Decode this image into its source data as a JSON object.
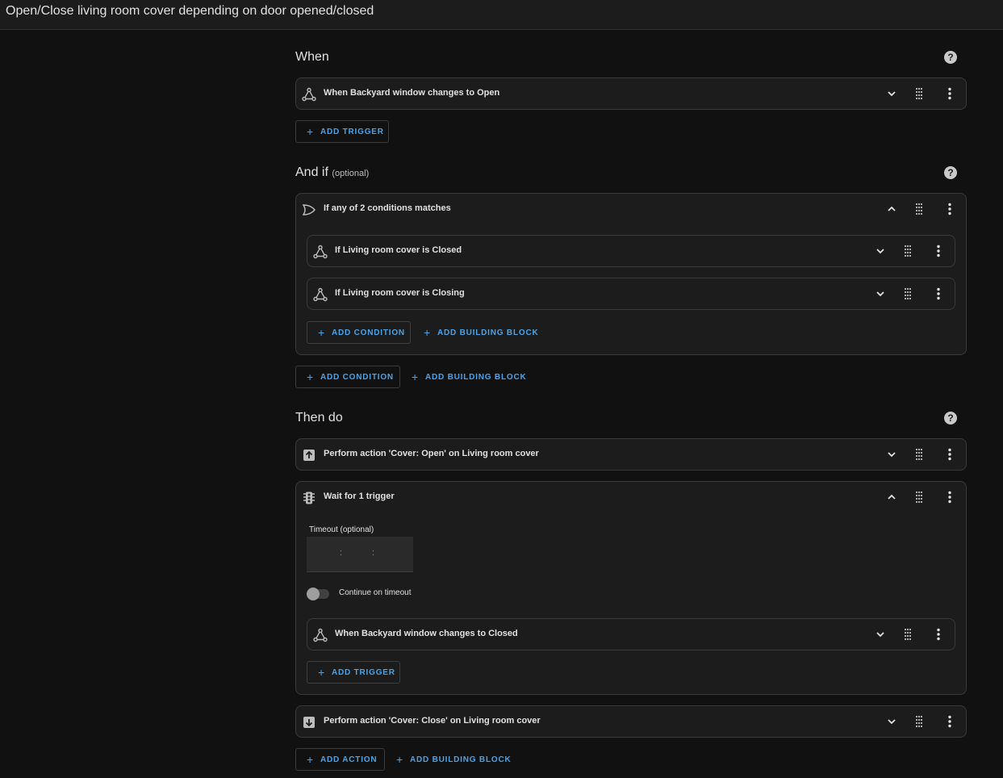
{
  "header": {
    "title": "Open/Close living room cover depending on door opened/closed"
  },
  "sections": {
    "when": {
      "title": "When"
    },
    "andif": {
      "title": "And if",
      "optional": "(optional)"
    },
    "then": {
      "title": "Then do"
    }
  },
  "help_icon": "?",
  "triggers": [
    {
      "label": "When Backyard window changes to Open",
      "icon": "trigger-icon"
    }
  ],
  "condition_group": {
    "label": "If any of 2 conditions matches",
    "icon": "or-gate-icon",
    "conditions": [
      {
        "label": "If Living room cover is Closed",
        "icon": "state-icon"
      },
      {
        "label": "If Living room cover is Closing",
        "icon": "state-icon"
      }
    ]
  },
  "actions": {
    "open": {
      "label": "Perform action 'Cover: Open' on Living room cover",
      "icon": "arrow-up-box-icon"
    },
    "wait": {
      "label": "Wait for 1 trigger",
      "icon": "traffic-light-icon",
      "timeout_label": "Timeout (optional)",
      "timeout_separator": ":",
      "continue_label": "Continue on timeout",
      "continue_on_timeout": false,
      "trigger": {
        "label": "When Backyard window changes to Closed",
        "icon": "trigger-icon"
      }
    },
    "close": {
      "label": "Perform action 'Cover: Close' on Living room cover",
      "icon": "arrow-down-box-icon"
    }
  },
  "buttons": {
    "plus": "+",
    "add_trigger": "ADD TRIGGER",
    "add_condition": "ADD CONDITION",
    "add_building_block": "ADD BUILDING BLOCK",
    "add_action": "ADD ACTION"
  },
  "colors": {
    "accent": "#4aa3e8",
    "background": "#111111",
    "card": "#1c1c1c"
  }
}
